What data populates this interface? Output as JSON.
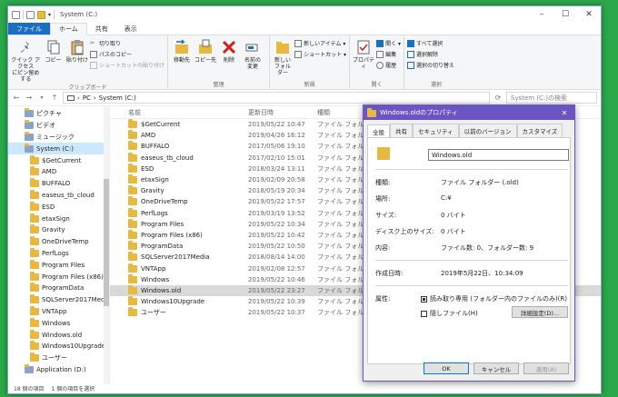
{
  "window": {
    "title": "System (C:)"
  },
  "ribbon_tabs": [
    "ファイル",
    "ホーム",
    "共有",
    "表示"
  ],
  "ribbon": {
    "clipboard": {
      "pin": "クイック アクセス\nにピン留めする",
      "copy": "コピー",
      "paste": "貼り付け",
      "cut": "切り取り",
      "copy_path": "パスのコピー",
      "paste_shortcut": "ショートカットの貼り付け",
      "label": "クリップボード"
    },
    "organize": {
      "move": "移動先",
      "copyto": "コピー先",
      "delete": "削除",
      "rename": "名前の\n変更",
      "label": "整理"
    },
    "new": {
      "newfolder": "新しい\nフォルダー",
      "newitem": "新しいアイテム ▾",
      "shortcut": "ショートカット ▾",
      "label": "新規"
    },
    "open": {
      "properties": "プロパティ",
      "open": "開く ▾",
      "edit": "編集",
      "history": "履歴",
      "label": "開く"
    },
    "select": {
      "all": "すべて選択",
      "none": "選択解除",
      "invert": "選択の切り替え",
      "label": "選択"
    }
  },
  "address": {
    "path1": "PC",
    "path2": "System (C:)",
    "search": "System (C:)の検索"
  },
  "tree": [
    {
      "label": "ピクチャ",
      "sub": false
    },
    {
      "label": "ビデオ",
      "sub": false
    },
    {
      "label": "ミュージック",
      "sub": false
    },
    {
      "label": "System (C:)",
      "sub": false,
      "sel": true
    },
    {
      "label": "$GetCurrent",
      "sub": true
    },
    {
      "label": "AMD",
      "sub": true
    },
    {
      "label": "BUFFALO",
      "sub": true
    },
    {
      "label": "easeus_tb_cloud",
      "sub": true
    },
    {
      "label": "ESD",
      "sub": true
    },
    {
      "label": "etaxSign",
      "sub": true
    },
    {
      "label": "Gravity",
      "sub": true
    },
    {
      "label": "OneDriveTemp",
      "sub": true
    },
    {
      "label": "PerfLogs",
      "sub": true
    },
    {
      "label": "Program Files",
      "sub": true
    },
    {
      "label": "Program Files (x86)",
      "sub": true
    },
    {
      "label": "ProgramData",
      "sub": true
    },
    {
      "label": "SQLServer2017Media",
      "sub": true
    },
    {
      "label": "VNTApp",
      "sub": true
    },
    {
      "label": "Windows",
      "sub": true
    },
    {
      "label": "Windows.old",
      "sub": true
    },
    {
      "label": "Windows10Upgrade",
      "sub": true
    },
    {
      "label": "ユーザー",
      "sub": true
    },
    {
      "label": "Application (D:)",
      "sub": false
    }
  ],
  "columns": {
    "name": "名前",
    "date": "更新日時",
    "type": "種類"
  },
  "files": [
    {
      "name": "$GetCurrent",
      "date": "2019/05/22 10:47",
      "type": "ファイル フォル"
    },
    {
      "name": "AMD",
      "date": "2019/04/26 16:12",
      "type": "ファイル フォル"
    },
    {
      "name": "BUFFALO",
      "date": "2017/05/06 19:10",
      "type": "ファイル フォル"
    },
    {
      "name": "easeus_tb_cloud",
      "date": "2017/02/10 15:01",
      "type": "ファイル フォル"
    },
    {
      "name": "ESD",
      "date": "2018/03/24 13:11",
      "type": "ファイル フォル"
    },
    {
      "name": "etaxSign",
      "date": "2019/02/09 20:58",
      "type": "ファイル フォル"
    },
    {
      "name": "Gravity",
      "date": "2018/05/19 20:34",
      "type": "ファイル フォル"
    },
    {
      "name": "OneDriveTemp",
      "date": "2019/05/22 17:57",
      "type": "ファイル フォル"
    },
    {
      "name": "PerfLogs",
      "date": "2019/03/19 13:52",
      "type": "ファイル フォル"
    },
    {
      "name": "Program Files",
      "date": "2019/05/22 10:34",
      "type": "ファイル フォル"
    },
    {
      "name": "Program Files (x86)",
      "date": "2019/05/22 10:42",
      "type": "ファイル フォル"
    },
    {
      "name": "ProgramData",
      "date": "2019/05/22 10:50",
      "type": "ファイル フォル"
    },
    {
      "name": "SQLServer2017Media",
      "date": "2018/08/14 14:00",
      "type": "ファイル フォル"
    },
    {
      "name": "VNTApp",
      "date": "2019/02/08 12:57",
      "type": "ファイル フォル"
    },
    {
      "name": "Windows",
      "date": "2019/05/22 10:46",
      "type": "ファイル フォル"
    },
    {
      "name": "Windows.old",
      "date": "2019/05/22 23:27",
      "type": "ファイル フォル",
      "sel": true
    },
    {
      "name": "Windows10Upgrade",
      "date": "2019/05/22 10:39",
      "type": "ファイル フォル"
    },
    {
      "name": "ユーザー",
      "date": "2019/05/22 10:37",
      "type": "ファイル フォル"
    }
  ],
  "status": {
    "count": "18 個の項目",
    "selected": "1 個の項目を選択"
  },
  "dialog": {
    "title": "Windows.oldのプロパティ",
    "tabs": [
      "全般",
      "共有",
      "セキュリティ",
      "以前のバージョン",
      "カスタマイズ"
    ],
    "name": "Windows.old",
    "props": [
      {
        "label": "種類:",
        "value": "ファイル フォルダー (.old)"
      },
      {
        "label": "場所:",
        "value": "C:¥"
      },
      {
        "label": "サイズ:",
        "value": "0 バイト"
      },
      {
        "label": "ディスク上のサイズ:",
        "value": "0 バイト"
      },
      {
        "label": "内容:",
        "value": "ファイル数: 0、フォルダー数: 9"
      },
      {
        "label": "作成日時:",
        "value": "2019年5月22日、10:34:09"
      }
    ],
    "attr_label": "属性:",
    "readonly": "読み取り専用 (フォルダー内のファイルのみ)(R)",
    "hidden": "隠しファイル(H)",
    "advanced": "詳細設定(D)...",
    "ok": "OK",
    "cancel": "キャンセル",
    "apply": "適用(A)"
  }
}
